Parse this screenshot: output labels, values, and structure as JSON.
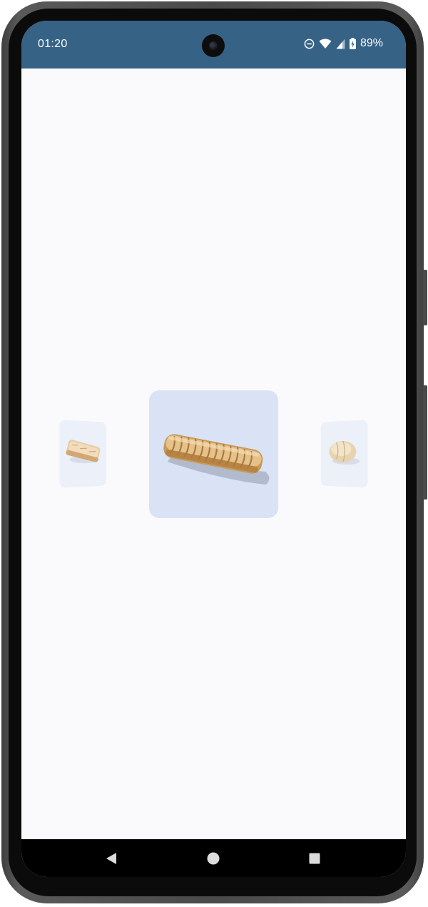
{
  "status_bar": {
    "time": "01:20",
    "battery_percent": "89%",
    "background_color": "#366286",
    "icons": [
      "do-not-disturb-icon",
      "wifi-icon",
      "cellular-signal-icon",
      "battery-charging-icon"
    ]
  },
  "carousel": {
    "items": [
      {
        "name": "pastry-slice",
        "position": "previous"
      },
      {
        "name": "sausage-roll-pastry",
        "position": "current"
      },
      {
        "name": "round-bread-bun",
        "position": "next"
      }
    ],
    "selected_index": 1,
    "selected_card_color": "#d9e3f5",
    "side_card_color": "#ecf0f9"
  },
  "nav_bar": {
    "icons": [
      "back-icon",
      "home-icon",
      "recents-icon"
    ]
  }
}
